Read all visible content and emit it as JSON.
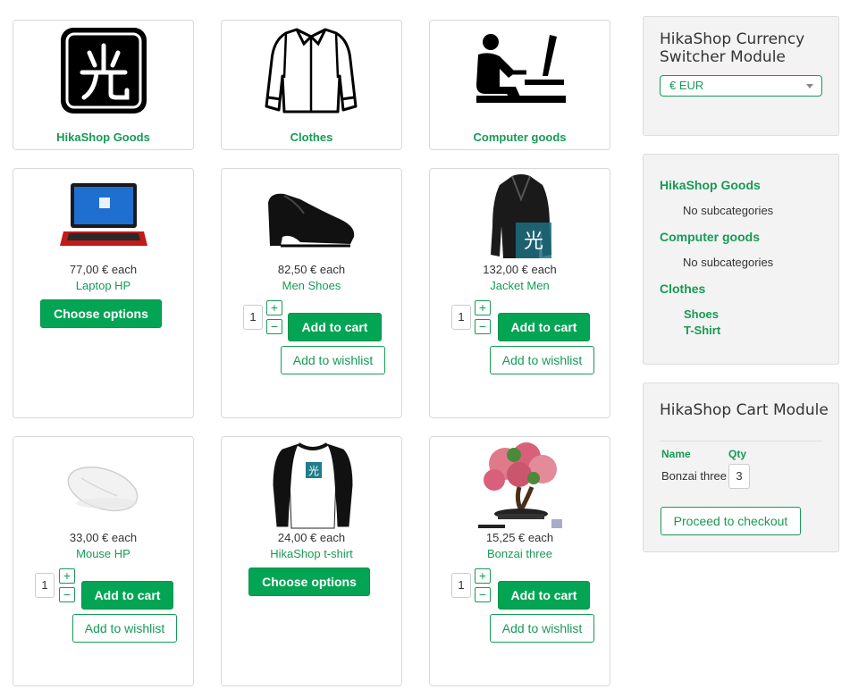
{
  "categories": [
    {
      "name": "HikaShop Goods",
      "icon": "hikashop-logo-icon"
    },
    {
      "name": "Clothes",
      "icon": "shirt-icon"
    },
    {
      "name": "Computer goods",
      "icon": "computer-user-icon"
    }
  ],
  "products": [
    {
      "price": "77,00 € each",
      "name": "Laptop HP",
      "icon": "laptop-icon",
      "choose_label": "Choose options"
    },
    {
      "price": "82,50 € each",
      "name": "Men Shoes",
      "icon": "shoe-icon",
      "qty": "1",
      "add_label": "Add to cart",
      "wishlist_label": "Add to wishlist"
    },
    {
      "price": "132,00 € each",
      "name": "Jacket Men",
      "icon": "jacket-icon",
      "qty": "1",
      "add_label": "Add to cart",
      "wishlist_label": "Add to wishlist"
    },
    {
      "price": "33,00 € each",
      "name": "Mouse HP",
      "icon": "mouse-icon",
      "qty": "1",
      "add_label": "Add to cart",
      "wishlist_label": "Add to wishlist"
    },
    {
      "price": "24,00 € each",
      "name": "HikaShop t-shirt",
      "icon": "tshirt-icon",
      "choose_label": "Choose options"
    },
    {
      "price": "15,25 € each",
      "name": "Bonzai three",
      "icon": "bonsai-icon",
      "qty": "1",
      "add_label": "Add to cart",
      "wishlist_label": "Add to wishlist"
    }
  ],
  "qty_plus": "+",
  "qty_minus": "−",
  "currency_module": {
    "title": "HikaShop Currency Switcher Module",
    "selected": "€ EUR"
  },
  "categories_module": {
    "items": [
      {
        "name": "HikaShop Goods",
        "sub": "No subcategories"
      },
      {
        "name": "Computer goods",
        "sub": "No subcategories"
      },
      {
        "name": "Clothes",
        "children": [
          "Shoes",
          "T-Shirt"
        ]
      }
    ]
  },
  "cart_module": {
    "title": "HikaShop Cart Module",
    "col_name": "Name",
    "col_qty": "Qty",
    "item_name": "Bonzai three",
    "item_qty": "3",
    "checkout_label": "Proceed to checkout"
  },
  "colors": {
    "accent": "#03a554",
    "link": "#179a56"
  }
}
